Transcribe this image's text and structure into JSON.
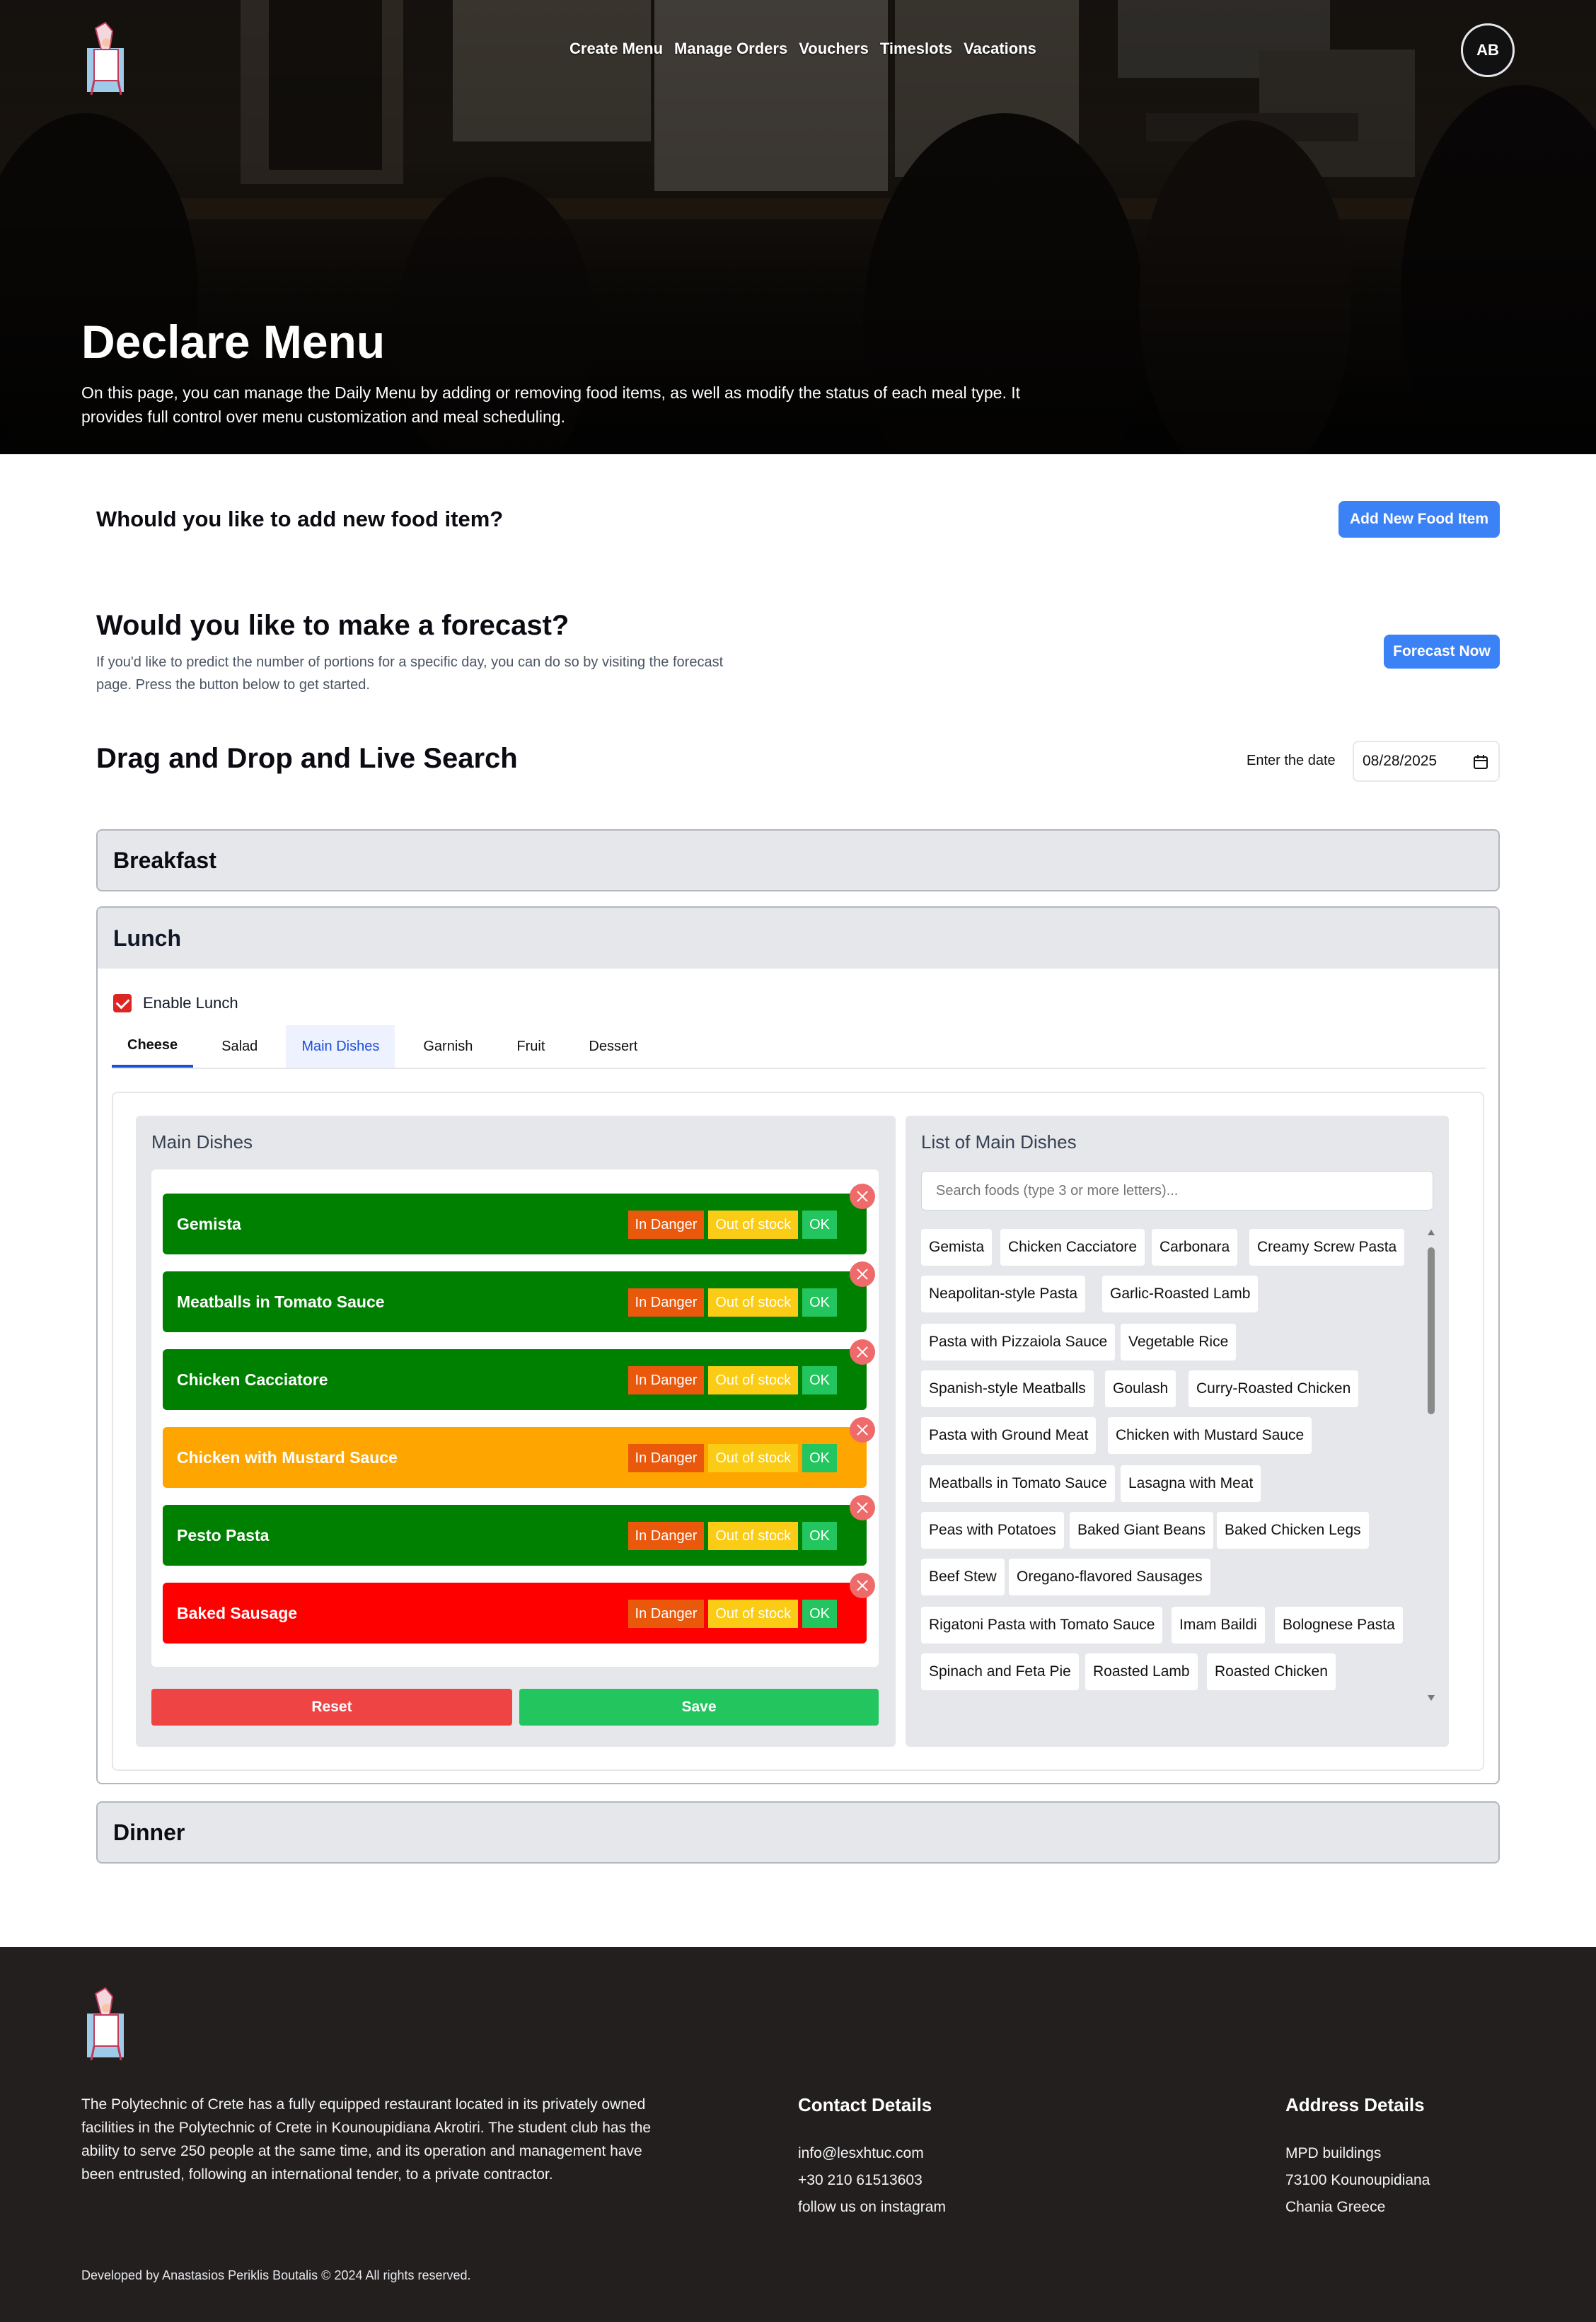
{
  "nav": {
    "items": [
      "Create Menu",
      "Manage Orders",
      "Vouchers",
      "Timeslots",
      "Vacations"
    ],
    "avatar_initials": "AB"
  },
  "hero": {
    "title": "Declare Menu",
    "description": "On this page, you can manage the Daily Menu by adding or removing food items, as well as modify the status of each meal type. It provides full control over menu customization and meal scheduling."
  },
  "add_food": {
    "question": "Whould you like to add new food item?",
    "button": "Add New Food Item"
  },
  "forecast": {
    "question": "Would you like to make a forecast?",
    "description": "If you'd like to predict the number of portions for a specific day, you can do so by visiting the forecast page. Press the button below to get started.",
    "button": "Forecast Now"
  },
  "dnd": {
    "title": "Drag and Drop and Live Search",
    "date_label": "Enter the date",
    "date_value": "08/28/2025"
  },
  "meals": {
    "breakfast": "Breakfast",
    "lunch": "Lunch",
    "dinner": "Dinner",
    "enable_lunch": "Enable Lunch"
  },
  "tabs": [
    "Cheese",
    "Salad",
    "Main Dishes",
    "Garnish",
    "Fruit",
    "Dessert"
  ],
  "main_dishes": {
    "title": "Main Dishes",
    "status_labels": {
      "danger": "In Danger",
      "out": "Out of stock",
      "ok": "OK"
    },
    "items": [
      {
        "name": "Gemista",
        "status": "ok",
        "color": "#008000"
      },
      {
        "name": "Meatballs in Tomato Sauce",
        "status": "ok",
        "color": "#008000"
      },
      {
        "name": "Chicken Cacciatore",
        "status": "ok",
        "color": "#008000"
      },
      {
        "name": "Chicken with Mustard Sauce",
        "status": "in-danger",
        "color": "#ffa500"
      },
      {
        "name": "Pesto Pasta",
        "status": "ok",
        "color": "#008000"
      },
      {
        "name": "Baked Sausage",
        "status": "out-of-stock",
        "color": "#ff0000"
      }
    ],
    "reset": "Reset",
    "save": "Save"
  },
  "list": {
    "title": "List of Main Dishes",
    "search_placeholder": "Search foods (type 3 or more letters)...",
    "rows": [
      [
        "Gemista",
        "Chicken Cacciatore",
        "Carbonara",
        "Creamy Screw Pasta"
      ],
      [
        "Neapolitan-style Pasta",
        "Garlic-Roasted Lamb"
      ],
      [
        "Pasta with Pizzaiola Sauce",
        "Vegetable Rice"
      ],
      [
        "Spanish-style Meatballs",
        "Goulash",
        "Curry-Roasted Chicken"
      ],
      [
        "Pasta with Ground Meat",
        "Chicken with Mustard Sauce"
      ],
      [
        "Meatballs in Tomato Sauce",
        "Lasagna with Meat"
      ],
      [
        "Peas with Potatoes",
        "Baked Giant Beans",
        "Baked Chicken Legs"
      ],
      [
        "Beef Stew",
        "Oregano-flavored Sausages"
      ],
      [
        "Rigatoni Pasta with Tomato Sauce",
        "Imam Baildi",
        "Bolognese Pasta"
      ],
      [
        "Spinach and Feta Pie",
        "Roasted Lamb",
        "Roasted Chicken"
      ]
    ]
  },
  "footer": {
    "about": "The Polytechnic of Crete has a fully equipped restaurant located in its privately owned facilities in the Polytechnic of Crete in Kounoupidiana Akrotiri. The student club has the ability to serve 250 people at the same time, and its operation and management have been entrusted, following an international tender, to a private contractor.",
    "contact_title": "Contact Details",
    "contact": [
      "info@lesxhtuc.com",
      "+30 210 61513603",
      "follow us on instagram"
    ],
    "address_title": "Address Details",
    "address": [
      "MPD buildings",
      "73100 Kounoupidiana",
      "Chania Greece"
    ],
    "copyright": "Developed by Anastasios Periklis Boutalis © 2024 All rights reserved."
  },
  "colors": {
    "accent": "#3b82f6",
    "ok": "#22c55e",
    "danger": "#ea580c",
    "out_of_stock": "#facc15",
    "footer_bg": "#231f1f"
  }
}
